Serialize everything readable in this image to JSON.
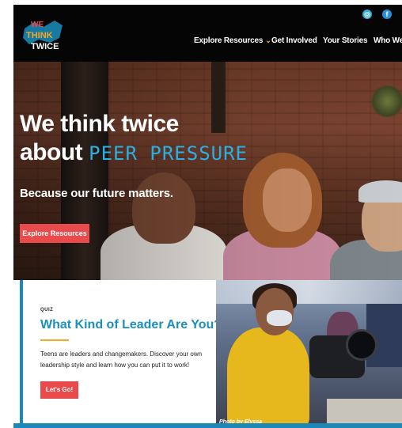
{
  "header": {
    "nav": [
      {
        "label": "Explore Resources",
        "has_dropdown": true
      },
      {
        "label": "Get Involved"
      },
      {
        "label": "Your Stories"
      },
      {
        "label": "Who We..."
      }
    ],
    "social": [
      {
        "name": "instagram-icon",
        "glyph": "◎"
      },
      {
        "name": "facebook-icon",
        "glyph": "f"
      }
    ],
    "logo_text": [
      "WE",
      "THINK",
      "TWICE"
    ]
  },
  "hero": {
    "headline_line1": "We think twice",
    "headline_line2_prefix": "about",
    "headline_accent": "PEER PRESSURE",
    "subtitle": "Because our future matters.",
    "cta_label": "Explore Resources"
  },
  "quiz_card": {
    "eyebrow": "QUIZ",
    "title": "What Kind of Leader Are You?",
    "description": "Teens are leaders and changemakers. Discover your own leadership style and learn how you can put it to work!",
    "cta_label": "Let's Go!"
  },
  "photo": {
    "credit": "Photo by Elyssa"
  },
  "colors": {
    "accent_blue": "#2ab0e4",
    "cta_red": "#e94a4b",
    "divider_orange": "#f6a723",
    "title_blue": "#1a8fc0"
  }
}
